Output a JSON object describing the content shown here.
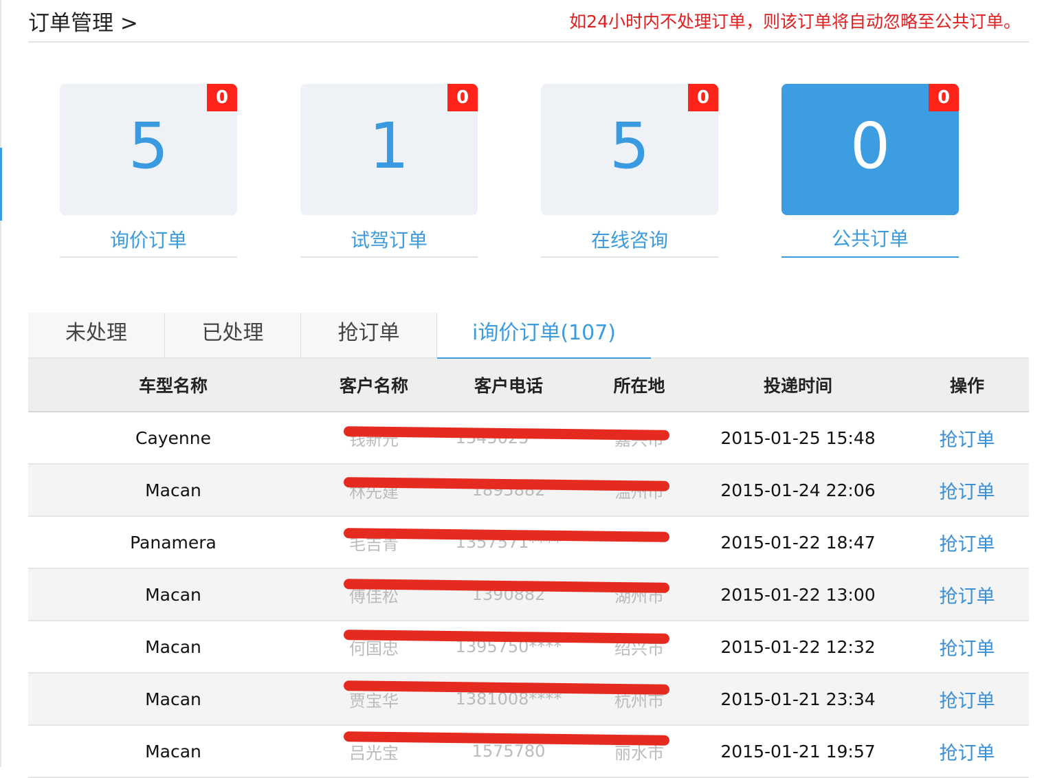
{
  "header": {
    "title": "订单管理 >",
    "notice": "如24小时内不处理订单，则该订单将自动忽略至公共订单。"
  },
  "cards": [
    {
      "count": "5",
      "badge": "0",
      "label": "询价订单",
      "active": false
    },
    {
      "count": "1",
      "badge": "0",
      "label": "试驾订单",
      "active": false
    },
    {
      "count": "5",
      "badge": "0",
      "label": "在线咨询",
      "active": false
    },
    {
      "count": "0",
      "badge": "0",
      "label": "公共订单",
      "active": true
    }
  ],
  "tabs": [
    {
      "label": "未处理"
    },
    {
      "label": "已处理"
    },
    {
      "label": "抢订单"
    },
    {
      "label": "i询价订单(107)",
      "current": true
    }
  ],
  "table": {
    "headers": [
      "车型名称",
      "客户名称",
      "客户电话",
      "所在地",
      "投递时间",
      "操作"
    ],
    "rows": [
      {
        "model": "Cayenne",
        "customer": "钱新元",
        "phone": "1345023****",
        "location": "嘉兴市",
        "time": "2015-01-25 15:48",
        "action": "抢订单"
      },
      {
        "model": "Macan",
        "customer": "林先建",
        "phone": "1895882",
        "location": "温州市",
        "time": "2015-01-24 22:06",
        "action": "抢订单"
      },
      {
        "model": "Panamera",
        "customer": "毛吉青",
        "phone": "1357571****",
        "location": "",
        "time": "2015-01-22 18:47",
        "action": "抢订单"
      },
      {
        "model": "Macan",
        "customer": "傅佳松",
        "phone": "1390882",
        "location": "湖州市",
        "time": "2015-01-22 13:00",
        "action": "抢订单"
      },
      {
        "model": "Macan",
        "customer": "何国忠",
        "phone": "1395750****",
        "location": "绍兴市",
        "time": "2015-01-22 12:32",
        "action": "抢订单"
      },
      {
        "model": "Macan",
        "customer": "贾宝华",
        "phone": "1381008****",
        "location": "杭州市",
        "time": "2015-01-21 23:34",
        "action": "抢订单"
      },
      {
        "model": "Macan",
        "customer": "吕光宝",
        "phone": "1575780",
        "location": "丽水市",
        "time": "2015-01-21 19:57",
        "action": "抢订单"
      }
    ]
  },
  "colors": {
    "accent": "#3c9bdc",
    "badge": "#ff2419",
    "notice": "#e02020",
    "redaction": "#e52a20"
  }
}
